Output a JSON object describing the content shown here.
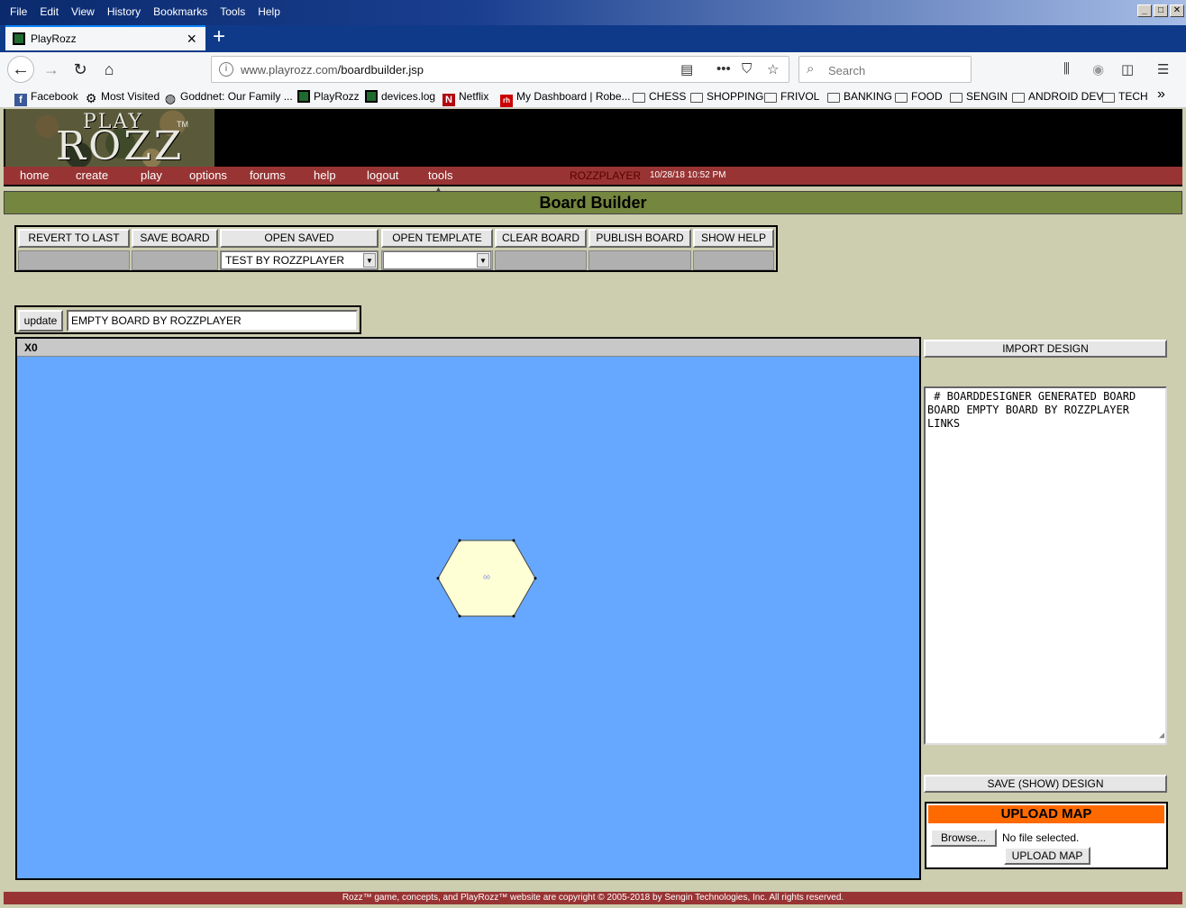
{
  "browser": {
    "menu": [
      "File",
      "Edit",
      "View",
      "History",
      "Bookmarks",
      "Tools",
      "Help"
    ],
    "tab_title": "PlayRozz",
    "url_host": "www.playrozz.com",
    "url_path": "/boardbuilder.jsp",
    "search_placeholder": "Search",
    "bookmarks": [
      "Facebook",
      "Most Visited",
      "Goddnet: Our Family ...",
      "PlayRozz",
      "devices.log",
      "Netflix",
      "My Dashboard | Robe...",
      "CHESS",
      "SHOPPING",
      "FRIVOL",
      "BANKING",
      "FOOD",
      "SENGIN",
      "ANDROID DEV",
      "TECH"
    ]
  },
  "site": {
    "logo_play": "PLAY",
    "logo_rozz": "ROZZ",
    "logo_tm": "TM",
    "nav": [
      "home",
      "create",
      "play",
      "options",
      "forums",
      "help",
      "logout",
      "tools"
    ],
    "user": "ROZZPLAYER",
    "datetime": "10/28/18 10:52 PM",
    "page_title": "Board Builder",
    "footer": "Rozz™ game, concepts, and PlayRozz™ website are copyright © 2005-2018 by Sengin Technologies, Inc. All rights reserved."
  },
  "toolbar": {
    "revert": "REVERT TO LAST",
    "save": "SAVE BOARD",
    "open_saved": "OPEN SAVED",
    "open_template": "OPEN TEMPLATE",
    "clear": "CLEAR BOARD",
    "publish": "PUBLISH BOARD",
    "show_help": "SHOW HELP",
    "saved_selected": "TEST BY ROZZPLAYER",
    "template_selected": ""
  },
  "namebar": {
    "update": "update",
    "board_name": "EMPTY BOARD BY ROZZPLAYER"
  },
  "canvas": {
    "header": "X0",
    "hex_label": "00"
  },
  "panel": {
    "import": "IMPORT DESIGN",
    "design_text": " # BOARDDESIGNER GENERATED BOARD\nBOARD EMPTY BOARD BY ROZZPLAYER\nLINKS",
    "save_design": "SAVE (SHOW) DESIGN",
    "upload_title": "UPLOAD MAP",
    "browse": "Browse...",
    "no_file": "No file selected.",
    "upload_btn": "UPLOAD MAP"
  },
  "colors": {
    "board_bg": "#66a8ff",
    "hex_fill": "#ffffd6",
    "nav_bg": "#983434",
    "title_bg": "#75863f",
    "upload_head": "#ff6a00"
  }
}
